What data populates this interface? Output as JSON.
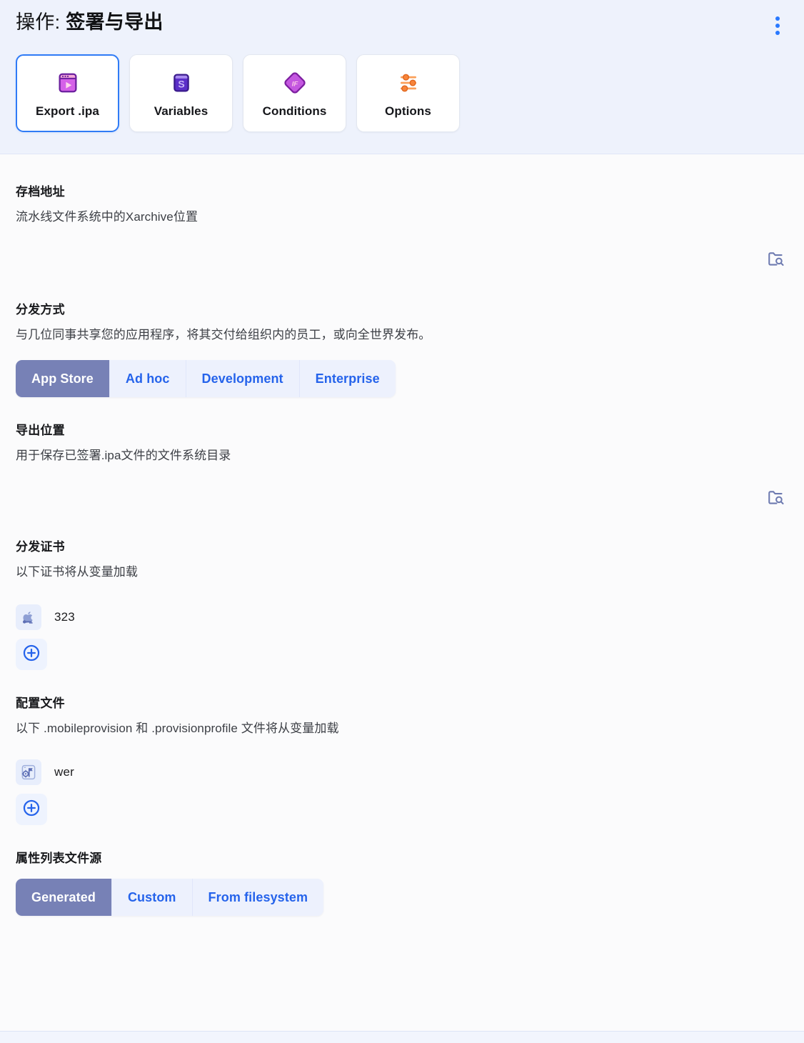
{
  "header": {
    "title_prefix": "操作: ",
    "title_main": "签署与导出",
    "menu_icon": "kebab-menu-icon"
  },
  "tabs": [
    {
      "label": "Export .ipa",
      "icon": "export-ipa-icon",
      "active": true
    },
    {
      "label": "Variables",
      "icon": "variables-icon",
      "active": false
    },
    {
      "label": "Conditions",
      "icon": "conditions-if-icon",
      "active": false
    },
    {
      "label": "Options",
      "icon": "options-sliders-icon",
      "active": false
    }
  ],
  "sections": {
    "archive": {
      "title": "存档地址",
      "description": "流水线文件系统中的Xarchive位置",
      "input_value": "",
      "input_placeholder": "",
      "browse_icon": "folder-search-icon"
    },
    "distribution": {
      "title": "分发方式",
      "description": "与几位同事共享您的应用程序，将其交付给组织内的员工，或向全世界发布。",
      "options": [
        "App Store",
        "Ad hoc",
        "Development",
        "Enterprise"
      ],
      "selected": "App Store"
    },
    "export_location": {
      "title": "导出位置",
      "description": "用于保存已签署.ipa文件的文件系统目录",
      "input_value": "",
      "input_placeholder": "",
      "browse_icon": "folder-search-icon"
    },
    "certificates": {
      "title": "分发证书",
      "description": "以下证书将从变量加载",
      "items": [
        {
          "name": "323",
          "icon": "apple-certificate-key-icon"
        }
      ],
      "add_icon": "plus-circle-icon"
    },
    "profiles": {
      "title": "配置文件",
      "description": "以下 .mobileprovision 和 .provisionprofile 文件将从变量加载",
      "items": [
        {
          "name": "wer",
          "icon": "provisioning-profile-icon"
        }
      ],
      "add_icon": "plus-circle-icon"
    },
    "plist_source": {
      "title": "属性列表文件源",
      "options": [
        "Generated",
        "Custom",
        "From filesystem"
      ],
      "selected": "Generated"
    }
  },
  "colors": {
    "accent_blue": "#2563eb",
    "active_segment": "#7781b6",
    "header_bg": "#eef2fc",
    "tab_active_border": "#2f7bf6"
  }
}
